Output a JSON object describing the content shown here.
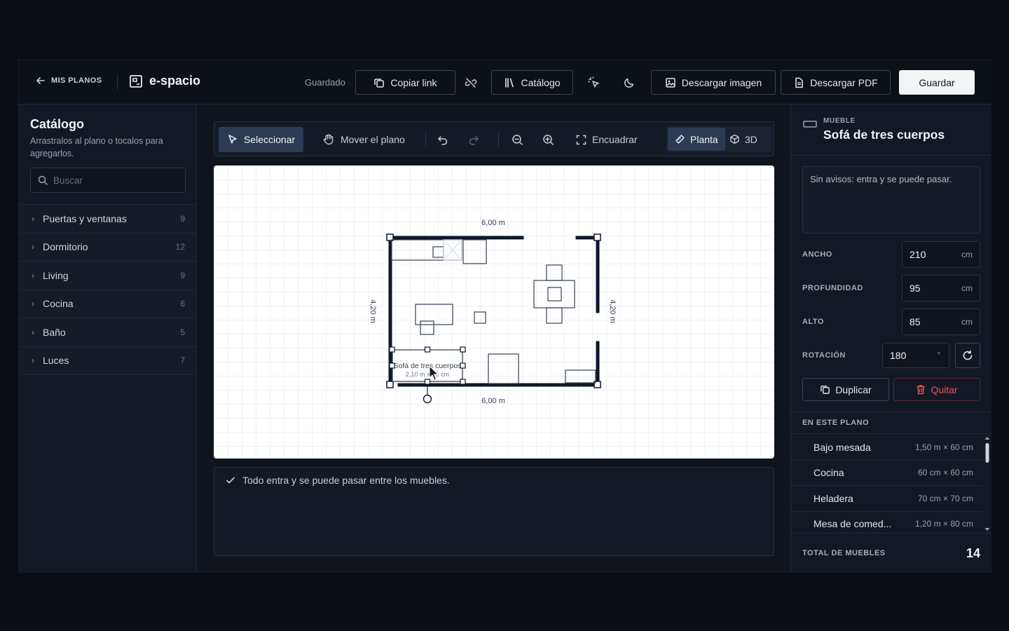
{
  "header": {
    "back_label": "MIS PLANOS",
    "brand": "e-spacio",
    "saved_status": "Guardado",
    "copy_link": "Copiar link",
    "catalog": "Catálogo",
    "download_image": "Descargar imagen",
    "download_pdf": "Descargar PDF",
    "save": "Guardar"
  },
  "sidebar": {
    "title": "Catálogo",
    "subtitle": "Arrastralos al plano o tocalos para agregarlos.",
    "search_placeholder": "Buscar",
    "categories": [
      {
        "label": "Puertas y ventanas",
        "count": "9"
      },
      {
        "label": "Dormitorio",
        "count": "12"
      },
      {
        "label": "Living",
        "count": "9"
      },
      {
        "label": "Cocina",
        "count": "6"
      },
      {
        "label": "Baño",
        "count": "5"
      },
      {
        "label": "Luces",
        "count": "7"
      }
    ]
  },
  "toolbar": {
    "select": "Seleccionar",
    "pan": "Mover el plano",
    "fit": "Encuadrar",
    "plan": "Planta",
    "view3d": "3D"
  },
  "plan": {
    "width_top": "6,00 m",
    "width_bottom": "6,00 m",
    "height_left": "4,20 m",
    "height_right": "4,20 m",
    "selected_label": "Sofá de tres cuerpos",
    "selected_dims": "2,10 m × 95 cm"
  },
  "status": {
    "message": "Todo entra y se puede pasar entre los muebles."
  },
  "panel": {
    "kicker": "MUEBLE",
    "title": "Sofá de tres cuerpos",
    "notes": "Sin avisos: entra y se puede pasar.",
    "fields": {
      "width_label": "ANCHO",
      "width_value": "210",
      "width_unit": "cm",
      "depth_label": "PROFUNDIDAD",
      "depth_value": "95",
      "depth_unit": "cm",
      "height_label": "ALTO",
      "height_value": "85",
      "height_unit": "cm",
      "rotation_label": "ROTACIÓN",
      "rotation_value": "180",
      "rotation_unit": "°"
    },
    "duplicate": "Duplicar",
    "remove": "Quitar",
    "section_title": "EN ESTE PLANO",
    "items": [
      {
        "name": "Bajo mesada",
        "dims": "1,50 m × 60 cm"
      },
      {
        "name": "Cocina",
        "dims": "60 cm × 60 cm"
      },
      {
        "name": "Heladera",
        "dims": "70 cm × 70 cm"
      },
      {
        "name": "Mesa de comed...",
        "dims": "1,20 m × 80 cm"
      }
    ],
    "total_label": "TOTAL DE MUEBLES",
    "total_value": "14"
  },
  "colors": {
    "accent": "#2c3a52",
    "danger": "#f05252",
    "wall": "#0f172a"
  }
}
